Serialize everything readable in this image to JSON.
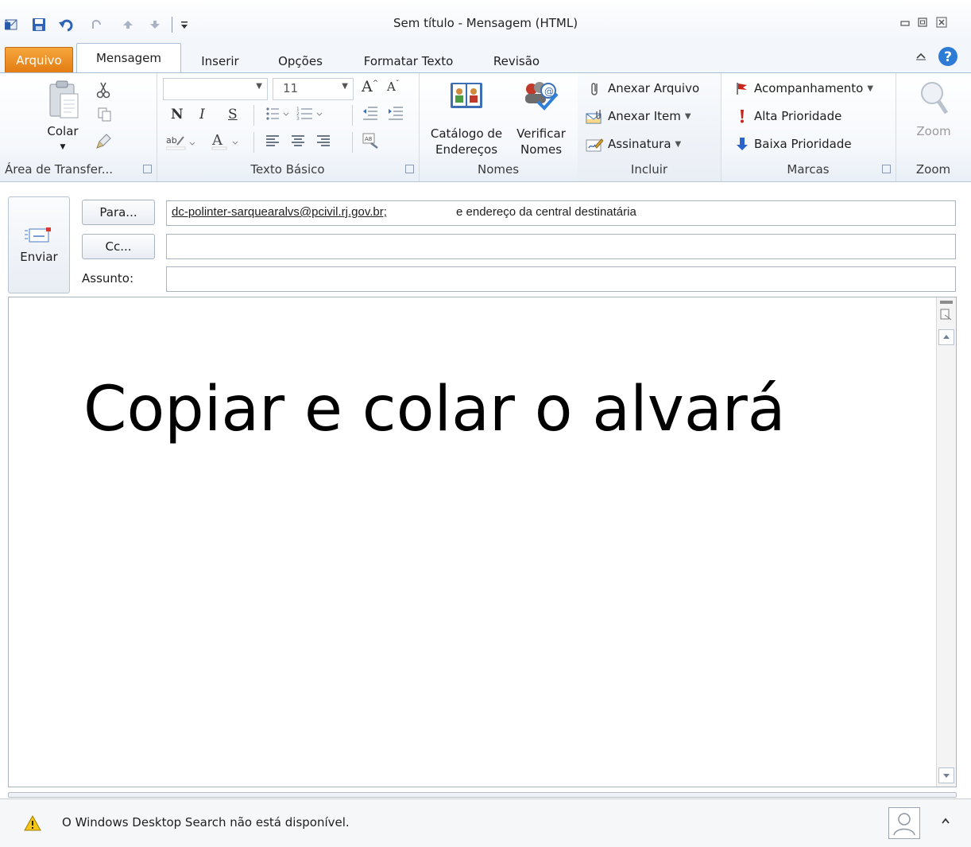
{
  "window": {
    "title": "Sem título - Mensagem (HTML)"
  },
  "quick_access": {
    "icons": [
      "outlook-icon",
      "save-icon",
      "undo-icon",
      "redo-icon",
      "up-arrow-icon",
      "down-arrow-icon",
      "customize-icon"
    ]
  },
  "tabs": [
    {
      "label": "Arquivo"
    },
    {
      "label": "Mensagem"
    },
    {
      "label": "Inserir"
    },
    {
      "label": "Opções"
    },
    {
      "label": "Formatar Texto"
    },
    {
      "label": "Revisão"
    }
  ],
  "ribbon": {
    "clipboard": {
      "label": "Área de Transfer...",
      "paste": "Colar"
    },
    "basic_text": {
      "label": "Texto Básico",
      "font_size": "11",
      "bold": "N",
      "italic": "I",
      "underline": "S"
    },
    "names": {
      "label": "Nomes",
      "address_book_l1": "Catálogo de",
      "address_book_l2": "Endereços",
      "check_l1": "Verificar",
      "check_l2": "Nomes"
    },
    "include": {
      "label": "Incluir",
      "attach_file": "Anexar Arquivo",
      "attach_item": "Anexar Item",
      "signature": "Assinatura"
    },
    "tags": {
      "label": "Marcas",
      "follow_up": "Acompanhamento",
      "high": "Alta Prioridade",
      "low": "Baixa Prioridade"
    },
    "zoom": {
      "label": "Zoom",
      "button": "Zoom"
    }
  },
  "compose": {
    "send": "Enviar",
    "to_button": "Para...",
    "cc_button": "Cc...",
    "subject_label": "Assunto:",
    "to_address": "dc-polinter-sarquearalvs@pcivil.rj.gov.br;",
    "to_note": "e endereço da central destinatária",
    "cc_value": "",
    "subject_value": ""
  },
  "body": {
    "text": "Copiar e colar o alvará"
  },
  "status": {
    "message": "O Windows Desktop Search não está disponível."
  },
  "colors": {
    "arquivo_tab": "#e27b12",
    "help": "#2e7bd6",
    "flag_red": "#c7241b",
    "priority_low": "#2b63c8"
  }
}
